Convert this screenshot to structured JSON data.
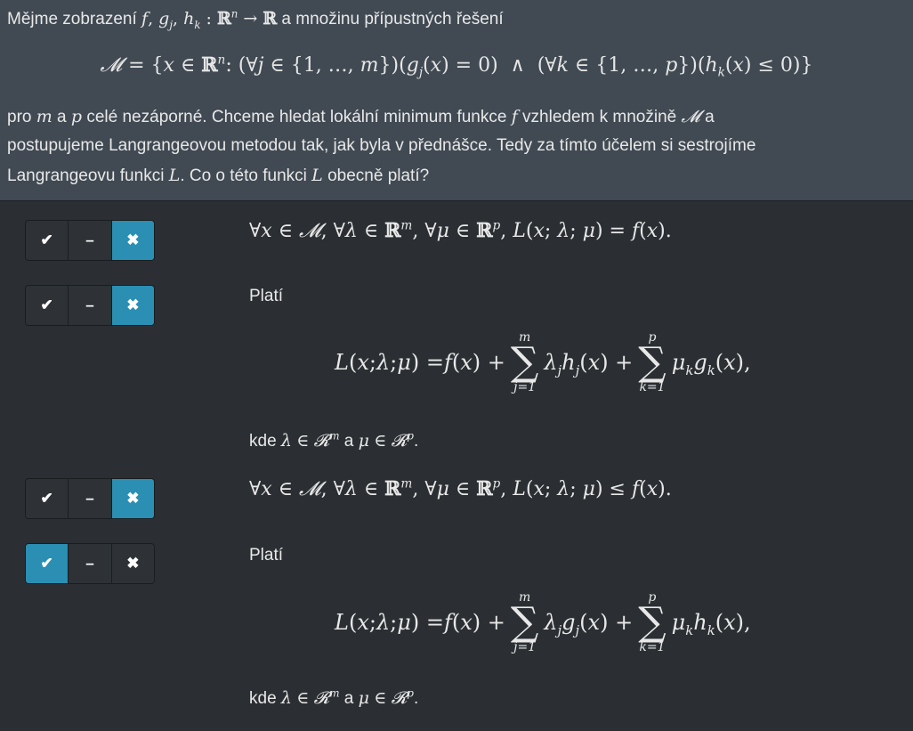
{
  "question": {
    "line1_prefix": "Mějme zobrazení",
    "line1_funcs": "f, g",
    "line1_suffix": "a množinu přípustných řešení",
    "formula_M": "𝓜 = {x ∈ ℝⁿ: (∀j ∈ {1, …, m})(gⱼ(x) = 0) ∧ (∀k ∈ {1, …, p})(hₖ(x) ≤ 0)}",
    "line3": "pro m a p celé nezáporné. Chceme hledat lokální minimum funkce f vzhledem k množině 𝓜 a",
    "line4": "postupujeme Langrangeovou metodou tak, jak byla v přednášce. Tedy za tímto účelem si sestrojíme",
    "line5": "Langrangeovu funkci L. Co o této funkci L obecně platí?"
  },
  "answer_buttons": {
    "yes": "✔",
    "neutral": "–",
    "no": "✖"
  },
  "options": [
    {
      "text": "∀x ∈ 𝓜, ∀λ ∈ ℝᵐ, ∀μ ∈ ℝᵖ, L(x; λ; μ) = f(x).",
      "selected": "no"
    },
    {
      "label": "Platí",
      "formula": "L(x; λ; μ) = f(x) + Σ_{j=1}^{m} λⱼhⱼ(x) + Σ_{k=1}^{p} μₖgₖ(x),",
      "kde": "kde λ ∈ 𝓡ᵐ a μ ∈ 𝓡ᵖ.",
      "selected": "no"
    },
    {
      "text": "∀x ∈ 𝓜, ∀λ ∈ ℝᵐ, ∀μ ∈ ℝᵖ, L(x; λ; μ) ≤ f(x).",
      "selected": "no"
    },
    {
      "label": "Platí",
      "formula": "L(x; λ; μ) = f(x) + Σ_{j=1}^{m} λⱼgⱼ(x) + Σ_{k=1}^{p} μₖhₖ(x),",
      "kde": "kde λ ∈ 𝓡ᵐ a μ ∈ 𝓡ᵖ.",
      "selected": "yes"
    }
  ],
  "colors": {
    "selected": "#2a8fb3",
    "header_bg": "#414a53",
    "body_bg": "#2b2f33"
  }
}
